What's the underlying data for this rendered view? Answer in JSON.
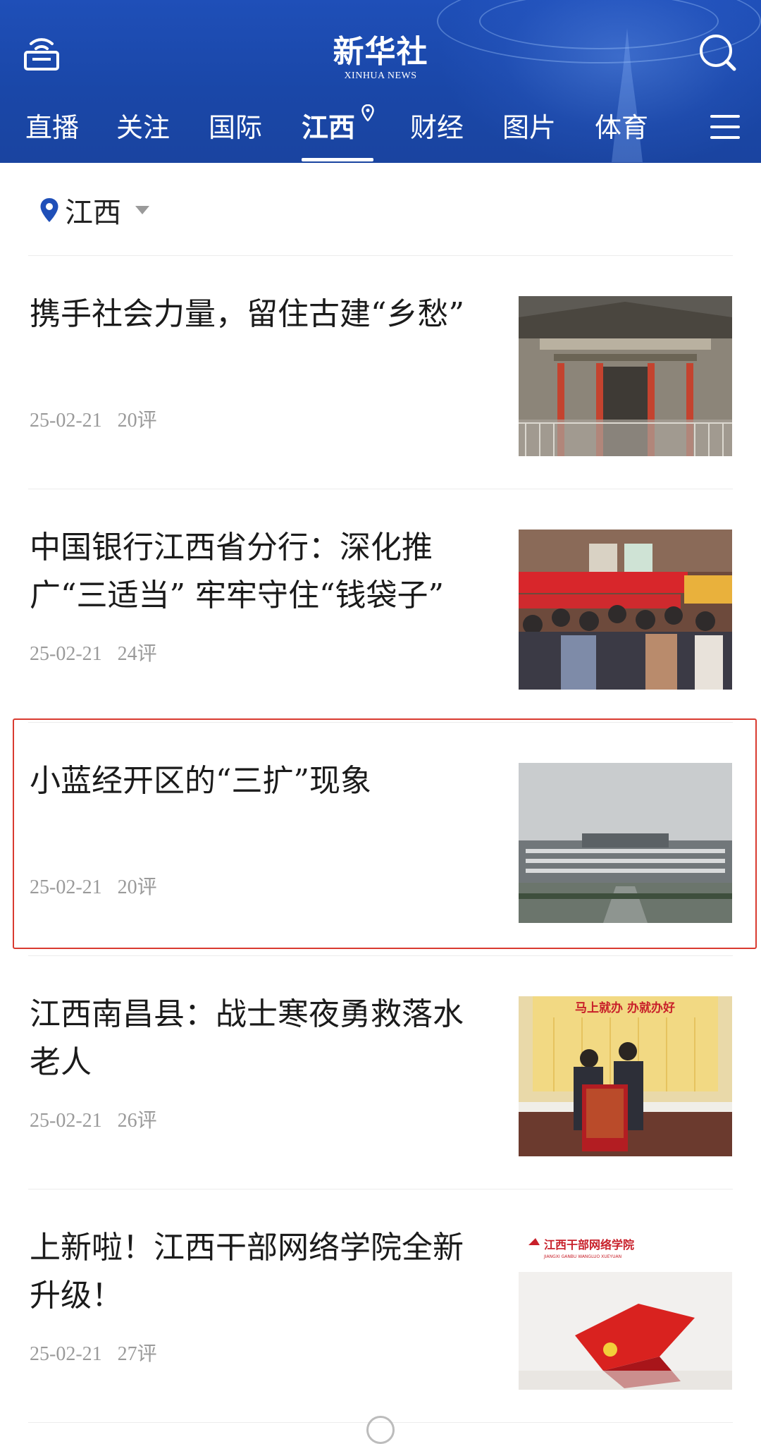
{
  "header": {
    "logo_cn": "新华社",
    "logo_en": "XINHUA NEWS",
    "tabs": [
      {
        "label": "直播"
      },
      {
        "label": "关注"
      },
      {
        "label": "国际"
      },
      {
        "label": "江西",
        "active": true
      },
      {
        "label": "财经"
      },
      {
        "label": "图片"
      },
      {
        "label": "体育"
      }
    ],
    "icons": [
      "radio-icon",
      "search-icon",
      "location-pin-icon",
      "menu-icon"
    ],
    "colors": {
      "header_bg": "#1f4fb8",
      "text": "#ffffff"
    }
  },
  "region": {
    "label": "江西",
    "icon": "location-pin-icon"
  },
  "articles": [
    {
      "title": "携手社会力量，留住古建“乡愁”",
      "date": "25-02-21",
      "comments": "20评",
      "thumb": "ancient-building-photo"
    },
    {
      "title": "中国银行江西省分行：深化推广“三适当” 牢牢守住“钱袋子”",
      "date": "25-02-21",
      "comments": "24评",
      "thumb": "bank-event-crowd-photo"
    },
    {
      "title": "小蓝经开区的“三扩”现象",
      "date": "25-02-21",
      "comments": "20评",
      "thumb": "government-building-photo"
    },
    {
      "title": "江西南昌县：战士寒夜勇救落水老人",
      "date": "25-02-21",
      "comments": "26评",
      "thumb": "banner-presentation-photo"
    },
    {
      "title": "上新啦！江西干部网络学院全新升级！",
      "date": "25-02-21",
      "comments": "27评",
      "thumb": "academy-logo-image"
    }
  ],
  "thumb_texts": {
    "banner_slogan": "马上就办 办就办好",
    "academy_name": "江西干部网络学院",
    "academy_en": "JIANGXI GANBU WANGLUO XUEYUAN"
  },
  "highlight_color": "#d93b30"
}
